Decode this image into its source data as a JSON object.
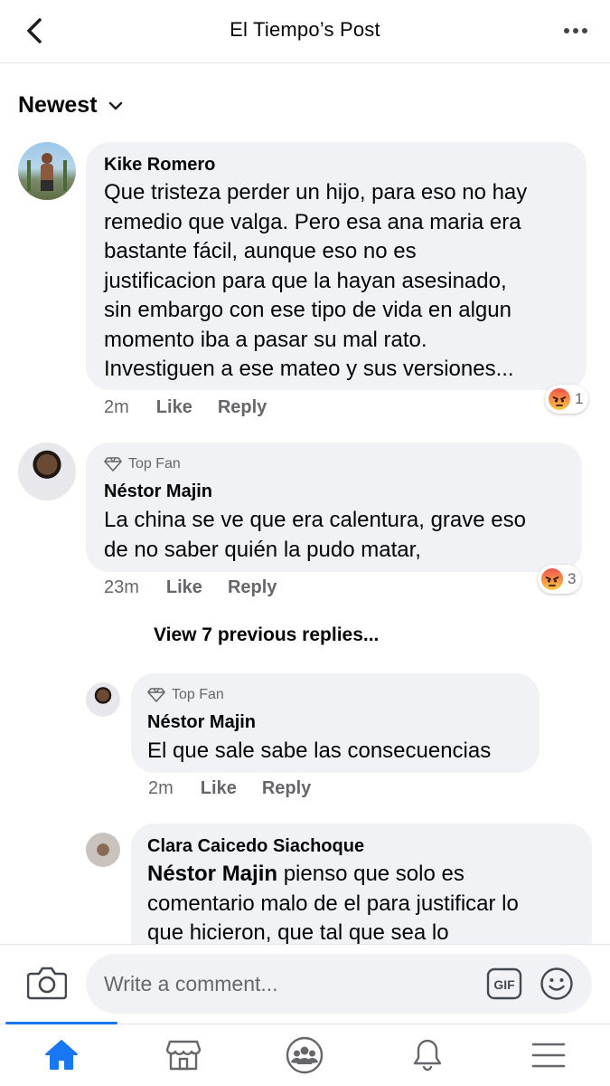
{
  "header": {
    "title": "El Tiempo’s Post",
    "back_icon": "chevron-left-icon",
    "more_icon": "more-dots-icon"
  },
  "sort": {
    "label": "Newest",
    "icon": "chevron-down-icon"
  },
  "comments": [
    {
      "author": "Kike Romero",
      "lines": [
        "Que tristeza perder un hijo, para eso no hay",
        "remedio que valga. Pero esa ana maria era",
        "bastante fácil, aunque eso no es",
        "justificacion para que la hayan asesinado,",
        "sin embargo  con ese tipo de vida en algun",
        "momento iba a pasar su mal rato.",
        "Investiguen a ese mateo y sus versiones..."
      ],
      "time": "2m",
      "like": "Like",
      "reply": "Reply",
      "reaction": {
        "icon": "angry-emoji-icon",
        "count": "1"
      }
    },
    {
      "badge": "Top Fan",
      "author": "Néstor Majin",
      "lines": [
        "La china se ve que era calentura, grave eso",
        "de no saber quién la pudo matar,"
      ],
      "time": "23m",
      "like": "Like",
      "reply": "Reply",
      "reaction": {
        "icon": "angry-emoji-icon",
        "count": "3"
      }
    }
  ],
  "view_previous": "View 7 previous replies...",
  "replies": [
    {
      "badge": "Top Fan",
      "author": "Néstor Majin",
      "lines": [
        "El que sale sabe las consecuencias"
      ],
      "time": "2m",
      "like": "Like",
      "reply": "Reply"
    },
    {
      "author": "Clara Caicedo Siachoque",
      "mention": "Néstor Majin",
      "lines": [
        " pienso que solo es",
        "comentario malo de el para justificar lo",
        "que hicieron, que tal que sea lo"
      ]
    }
  ],
  "composer": {
    "placeholder": "Write a comment...",
    "camera_icon": "camera-icon",
    "gif_label": "GIF",
    "emoji_icon": "smiley-icon"
  },
  "tabbar": {
    "items": [
      "home-icon",
      "marketplace-icon",
      "groups-icon",
      "notifications-icon",
      "menu-icon"
    ],
    "active_color": "#1877f2"
  },
  "colors": {
    "bubble": "#f0f2f5",
    "meta_text": "#65676b",
    "accent": "#1877f2"
  }
}
